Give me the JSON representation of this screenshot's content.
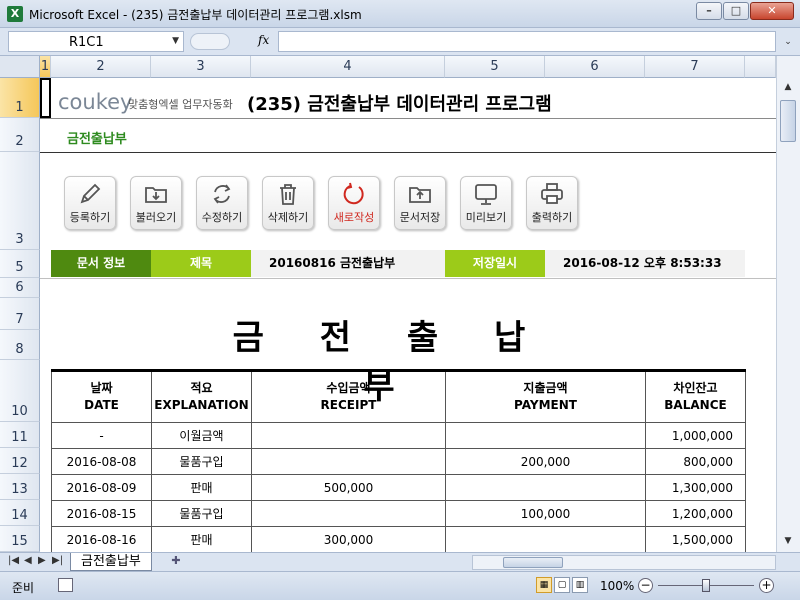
{
  "window": {
    "title": "Microsoft Excel - (235) 금전출납부 데이터관리 프로그램.xlsm",
    "app_icon": "excel-icon"
  },
  "formula_bar": {
    "name_box": "R1C1",
    "fx_label": "fx",
    "formula": ""
  },
  "columns": [
    "1",
    "2",
    "3",
    "4",
    "5",
    "6",
    "7"
  ],
  "rows": [
    "1",
    "2",
    "3",
    "5",
    "6",
    "7",
    "8",
    "10",
    "11",
    "12",
    "13",
    "14",
    "15"
  ],
  "header": {
    "brand_logo": "coukey",
    "brand_tagline": "맞춤형엑셀 업무자동화",
    "program_title": "(235) 금전출납부 데이터관리 프로그램",
    "subtitle": "금전출납부"
  },
  "toolbar": [
    {
      "label": "등록하기",
      "icon": "pencil-icon"
    },
    {
      "label": "불러오기",
      "icon": "folder-open-icon"
    },
    {
      "label": "수정하기",
      "icon": "refresh-icon"
    },
    {
      "label": "삭제하기",
      "icon": "trash-icon"
    },
    {
      "label": "새로작성",
      "icon": "new-circle-icon"
    },
    {
      "label": "문서저장",
      "icon": "folder-save-icon"
    },
    {
      "label": "미리보기",
      "icon": "monitor-icon"
    },
    {
      "label": "출력하기",
      "icon": "printer-icon"
    }
  ],
  "doc_info": {
    "section_label": "문서 정보",
    "title_label": "제목",
    "title_value": "20160816 금전출납부",
    "saved_label": "저장일시",
    "saved_value": "2016-08-12 오후 8:53:33"
  },
  "ledger": {
    "title": "금 전 출 납 부",
    "headers": [
      {
        "ko": "날짜",
        "en": "DATE"
      },
      {
        "ko": "적요",
        "en": "EXPLANATION"
      },
      {
        "ko": "수입금액",
        "en": "RECEIPT"
      },
      {
        "ko": "지출금액",
        "en": "PAYMENT"
      },
      {
        "ko": "차인잔고",
        "en": "BALANCE"
      }
    ],
    "rows": [
      {
        "date": "-",
        "explanation": "이월금액",
        "receipt": "",
        "payment": "",
        "balance": "1,000,000"
      },
      {
        "date": "2016-08-08",
        "explanation": "물품구입",
        "receipt": "",
        "payment": "200,000",
        "balance": "800,000"
      },
      {
        "date": "2016-08-09",
        "explanation": "판매",
        "receipt": "500,000",
        "payment": "",
        "balance": "1,300,000"
      },
      {
        "date": "2016-08-15",
        "explanation": "물품구입",
        "receipt": "",
        "payment": "100,000",
        "balance": "1,200,000"
      },
      {
        "date": "2016-08-16",
        "explanation": "판매",
        "receipt": "300,000",
        "payment": "",
        "balance": "1,500,000"
      }
    ]
  },
  "sheet_tabs": {
    "active": "금전출납부"
  },
  "status": {
    "text": "준비",
    "zoom": "100%"
  },
  "colors": {
    "info_dark_green": "#4f8a10",
    "info_light_green": "#9ccb19",
    "subtitle_green": "#2e8b1f",
    "new_button_red": "#d0281f"
  }
}
